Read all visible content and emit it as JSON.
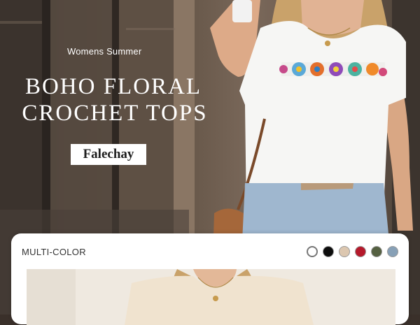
{
  "hero": {
    "subtitle": "Womens Summer",
    "title_line1": "BOHO FLORAL",
    "title_line2": "CROCHET TOPS",
    "brand": "Falechay"
  },
  "variant_card": {
    "label": "MULTI-COLOR",
    "swatches": [
      {
        "name": "white",
        "color": "#ffffff",
        "selected": true
      },
      {
        "name": "black",
        "color": "#0d0d0d",
        "selected": false
      },
      {
        "name": "apricot",
        "color": "#dcc7b0",
        "selected": false
      },
      {
        "name": "red",
        "color": "#b5192b",
        "selected": false
      },
      {
        "name": "olive-green",
        "color": "#556041",
        "selected": false
      },
      {
        "name": "blue-grey",
        "color": "#87a0b6",
        "selected": false
      }
    ]
  }
}
